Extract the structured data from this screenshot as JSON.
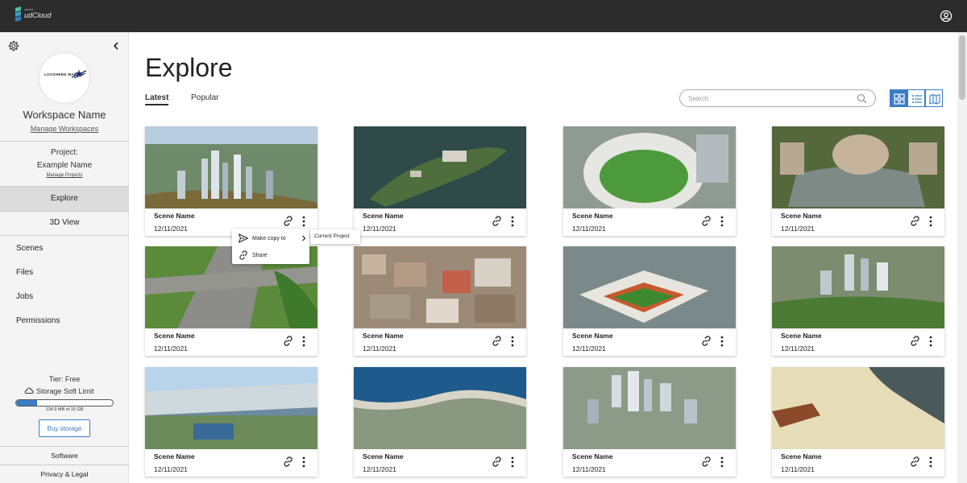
{
  "app": {
    "brand_small": "cubed",
    "brand": "udCloud"
  },
  "sidebar": {
    "workspace_logo_text": "LOCKHEED MARTIN",
    "workspace_name": "Workspace Name",
    "manage_workspaces": "Manage Workspaces",
    "project_label": "Project:",
    "project_name": "Example Name",
    "manage_projects": "Manage Projects",
    "main_nav": [
      {
        "label": "Explore",
        "active": true
      },
      {
        "label": "3D View",
        "active": false
      }
    ],
    "sub_nav": [
      "Scenes",
      "Files",
      "Jobs",
      "Permissions"
    ],
    "tier": "Tier: Free",
    "storage_label": "Storage Soft Limit",
    "storage_fill_percent": 22,
    "storage_text": "134.9 MB of 15 GB",
    "buy_storage": "Buy storage",
    "footer_links": [
      "Software",
      "Privacy & Legal"
    ]
  },
  "main": {
    "title": "Explore",
    "tabs": [
      {
        "label": "Latest",
        "active": true
      },
      {
        "label": "Popular",
        "active": false
      }
    ],
    "search": {
      "placeholder": "Search"
    },
    "view_modes": [
      {
        "icon": "grid-icon",
        "active": true
      },
      {
        "icon": "list-icon",
        "active": false
      },
      {
        "icon": "map-icon",
        "active": false
      }
    ],
    "cards": [
      {
        "name": "Scene Name",
        "date": "12/11/2021"
      },
      {
        "name": "Scene Name",
        "date": "12/11/2021"
      },
      {
        "name": "Scene Name",
        "date": "12/11/2021"
      },
      {
        "name": "Scene Name",
        "date": "12/11/2021"
      },
      {
        "name": "Scene Name",
        "date": "12/11/2021"
      },
      {
        "name": "Scene Name",
        "date": "12/11/2021"
      },
      {
        "name": "Scene Name",
        "date": "12/11/2021"
      },
      {
        "name": "Scene Name",
        "date": "12/11/2021"
      },
      {
        "name": "Scene Name",
        "date": "12/11/2021"
      },
      {
        "name": "Scene Name",
        "date": "12/11/2021"
      },
      {
        "name": "Scene Name",
        "date": "12/11/2021"
      },
      {
        "name": "Scene Name",
        "date": "12/11/2021"
      }
    ]
  },
  "context_menu": {
    "items": [
      {
        "label": "Make copy to",
        "icon": "send-icon",
        "has_submenu": true
      },
      {
        "label": "Share",
        "icon": "link-icon",
        "has_submenu": false
      }
    ],
    "submenu_items": [
      "Current Project"
    ]
  },
  "colors": {
    "accent": "#3a7cc5",
    "topbar": "#2c2c2c",
    "sidebar_bg": "#f4f4f4"
  }
}
